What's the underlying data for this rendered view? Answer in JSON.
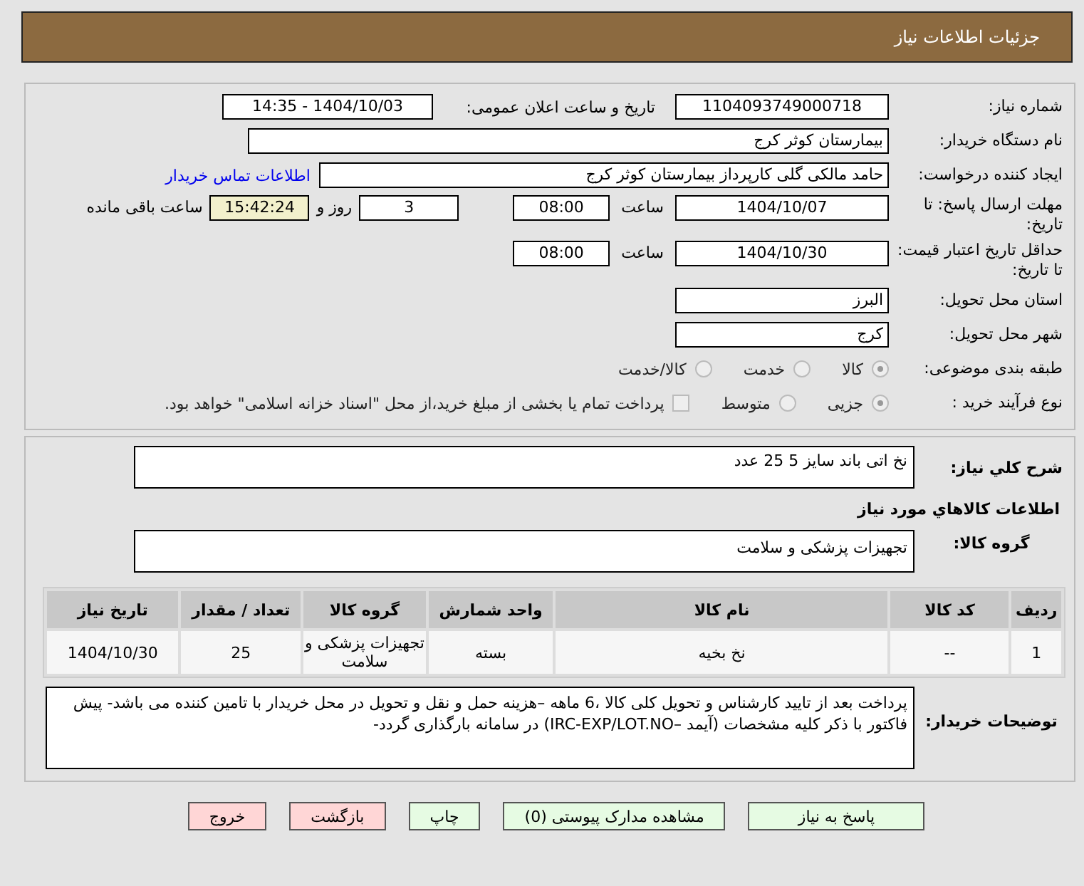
{
  "header": {
    "title": "جزئیات اطلاعات نیاز"
  },
  "need_number": {
    "label": "شماره نیاز:",
    "value": "1104093749000718"
  },
  "announce": {
    "label": "تاریخ و ساعت اعلان عمومی:",
    "value": "1404/10/03 - 14:35"
  },
  "buyer_org": {
    "label": "نام دستگاه خریدار:",
    "value": "بیمارستان کوثر کرج"
  },
  "requester": {
    "label": "ایجاد کننده درخواست:",
    "value": "حامد مالکی گلی کارپرداز بیمارستان کوثر کرج",
    "link": "اطلاعات تماس خریدار"
  },
  "deadline": {
    "label": "مهلت ارسال پاسخ: تا تاریخ:",
    "date": "1404/10/07",
    "time_label": "ساعت",
    "time": "08:00",
    "days": "3",
    "days_label": "روز و",
    "remaining": "15:42:24",
    "remaining_label": "ساعت باقی مانده"
  },
  "validity": {
    "label": "حداقل تاریخ اعتبار قیمت: تا تاریخ:",
    "date": "1404/10/30",
    "time_label": "ساعت",
    "time": "08:00"
  },
  "province": {
    "label": "استان محل تحویل:",
    "value": "البرز"
  },
  "city": {
    "label": "شهر محل تحویل:",
    "value": "کرج"
  },
  "category": {
    "label": "طبقه بندی موضوعی:",
    "options": [
      {
        "label": "کالا",
        "selected": true
      },
      {
        "label": "خدمت",
        "selected": false
      },
      {
        "label": "کالا/خدمت",
        "selected": false
      }
    ]
  },
  "process": {
    "label": "نوع فرآیند خرید :",
    "options": [
      {
        "label": "جزیی",
        "selected": true
      },
      {
        "label": "متوسط",
        "selected": false
      }
    ],
    "treasury": {
      "checked": false,
      "label": "پرداخت تمام یا بخشی از مبلغ خرید،از محل \"اسناد خزانه اسلامی\" خواهد بود."
    }
  },
  "description": {
    "label": "شرح کلي نياز:",
    "value": "نخ اتی باند سایز 5    25 عدد"
  },
  "items_title": "اطلاعات کالاهاي مورد نياز",
  "goods_group": {
    "label": "گروه کالا:",
    "value": "تجهیزات پزشکی و سلامت"
  },
  "table": {
    "columns": [
      "ردیف",
      "کد کالا",
      "نام کالا",
      "واحد شمارش",
      "گروه کالا",
      "تعداد / مقدار",
      "تاریخ نیاز"
    ],
    "rows": [
      [
        "1",
        "--",
        "نخ بخیه",
        "بسته",
        "تجهیزات پزشکی و سلامت",
        "25",
        "1404/10/30"
      ]
    ]
  },
  "notes": {
    "label": "توضیحات خریدار:",
    "value": "پرداخت بعد از تایید کارشناس و تحویل کلی کالا ،6 ماهه –هزینه حمل و نقل و تحویل در محل خریدار با تامین کننده می باشد- پیش فاکتور با ذکر کلیه مشخصات (آیمد –IRC-EXP/LOT.NO) در سامانه بارگذاری گردد-"
  },
  "buttons": [
    {
      "label": "پاسخ به نیاز",
      "kind": "action"
    },
    {
      "label": "مشاهده مدارک پیوستی (0)",
      "kind": "action"
    },
    {
      "label": "چاپ",
      "kind": "action"
    },
    {
      "label": "بازگشت",
      "kind": "exit"
    },
    {
      "label": "خروج",
      "kind": "exit"
    }
  ]
}
